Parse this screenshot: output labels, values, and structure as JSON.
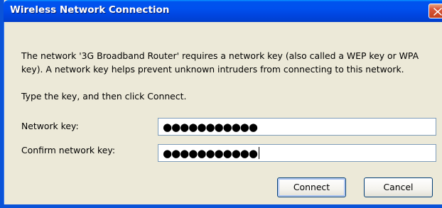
{
  "window": {
    "title": "Wireless Network Connection",
    "close_icon": "close-icon"
  },
  "message": {
    "line1": "The network '3G Broadband Router' requires a network key (also called a WEP key or WPA",
    "line2": "key). A network key helps prevent unknown intruders from connecting to this network.",
    "instruction": "Type the key, and then click Connect."
  },
  "form": {
    "network_key_label": "Network key:",
    "network_key_value": "●●●●●●●●●●●",
    "confirm_key_label": "Confirm network key:",
    "confirm_key_value": "●●●●●●●●●●●"
  },
  "buttons": {
    "connect": "Connect",
    "cancel": "Cancel"
  },
  "colors": {
    "titlebar": "#0050ee",
    "window_bg": "#ece9d8",
    "close_button": "#d9583a"
  }
}
